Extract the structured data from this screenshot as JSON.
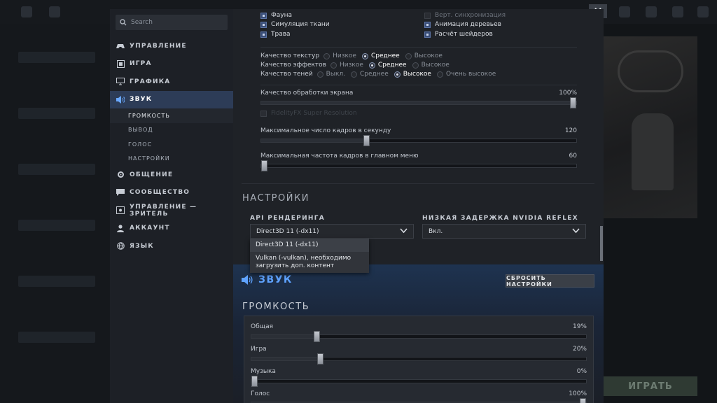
{
  "background": {
    "play_button": "ИГРАТЬ"
  },
  "sidebar": {
    "search_placeholder": "Search",
    "items": [
      {
        "label": "УПРАВЛЕНИЕ",
        "icon": "gamepad-icon"
      },
      {
        "label": "ИГРА",
        "icon": "game-icon"
      },
      {
        "label": "ГРАФИКА",
        "icon": "monitor-icon"
      },
      {
        "label": "ЗВУК",
        "icon": "speaker-icon"
      },
      {
        "label": "ОБЩЕНИЕ",
        "icon": "gear-icon"
      },
      {
        "label": "СООБЩЕСТВО",
        "icon": "chat-icon"
      },
      {
        "label": "УПРАВЛЕНИЕ — ЗРИТЕЛЬ",
        "icon": "eye-icon"
      },
      {
        "label": "АККАУНТ",
        "icon": "user-icon"
      },
      {
        "label": "ЯЗЫК",
        "icon": "globe-icon"
      }
    ],
    "sound_subitems": [
      "ГРОМКОСТЬ",
      "ВЫВОД",
      "ГОЛОС",
      "НАСТРОЙКИ"
    ]
  },
  "graphics": {
    "checkboxes_left": [
      "Фауна",
      "Симуляция ткани",
      "Трава"
    ],
    "checkboxes_right": [
      "Верт. синхронизация",
      "Анимация деревьев",
      "Расчёт шейдеров"
    ],
    "texture_quality": {
      "label": "Качество текстур",
      "options": [
        "Низкое",
        "Среднее",
        "Высокое"
      ],
      "selected": "Среднее"
    },
    "effects_quality": {
      "label": "Качество эффектов",
      "options": [
        "Низкое",
        "Среднее",
        "Высокое"
      ],
      "selected": "Среднее"
    },
    "shadow_quality": {
      "label": "Качество теней",
      "options": [
        "Выкл.",
        "Среднее",
        "Высокое",
        "Очень высокое"
      ],
      "selected": "Высокое"
    },
    "screen_quality": {
      "label": "Качество обработки экрана",
      "value": "100%",
      "fraction": 1.0
    },
    "fsr": "FidelityFX Super Resolution",
    "max_fps": {
      "label": "Максимальное число кадров в секунду",
      "value": "120",
      "fraction": 0.33
    },
    "menu_fps": {
      "label": "Максимальная частота кадров в главном меню",
      "value": "60",
      "fraction": 0.0
    }
  },
  "settings": {
    "heading": "НАСТРОЙКИ",
    "api": {
      "label": "API РЕНДЕРИНГА",
      "value": "Direct3D 11 (-dx11)",
      "options": [
        "Direct3D 11 (-dx11)",
        "Vulkan (-vulkan), необходимо загрузить доп. контент"
      ]
    },
    "reflex": {
      "label": "НИЗКАЯ ЗАДЕРЖКА NVIDIA REFLEX",
      "value": "Вкл."
    }
  },
  "sound": {
    "title": "ЗВУК",
    "reset": "СБРОСИТЬ НАСТРОЙКИ",
    "volume_heading": "ГРОМКОСТЬ",
    "sliders": [
      {
        "label": "Общая",
        "value": "19%",
        "fraction": 0.19
      },
      {
        "label": "Игра",
        "value": "20%",
        "fraction": 0.2
      },
      {
        "label": "Музыка",
        "value": "0%",
        "fraction": 0.0
      },
      {
        "label": "Голос",
        "value": "100%",
        "fraction": 1.0
      }
    ]
  }
}
